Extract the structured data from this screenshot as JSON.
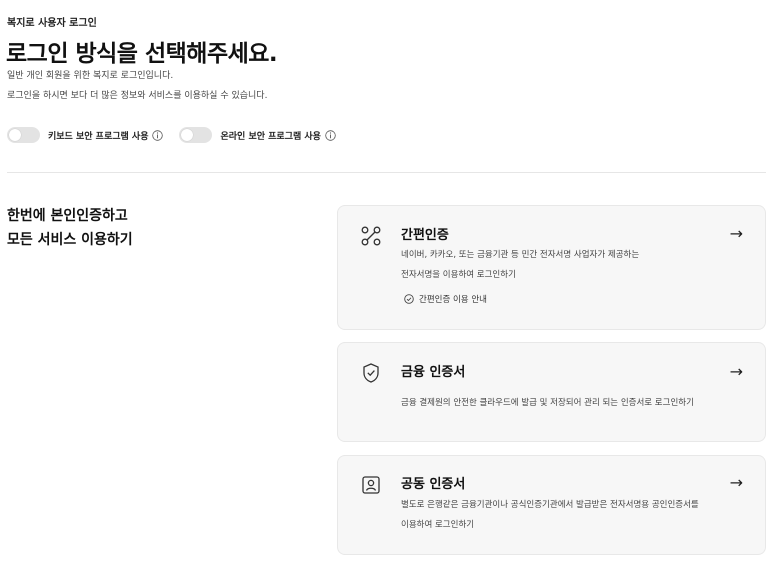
{
  "header": {
    "eyebrow": "복지로 사용자 로그인",
    "title": "로그인 방식을 선택해주세요.",
    "desc_1": "일반 개인 회원을 위한 복지로 로그인입니다.",
    "desc_2": "로그인을 하시면 보다 더 많은 정보와 서비스를 이용하실 수 있습니다."
  },
  "toggles": [
    {
      "label": "키보드 보안 프로그램 사용",
      "state": "off"
    },
    {
      "label": "온라인 보안 프로그램 사용",
      "state": "off"
    }
  ],
  "promo": {
    "line_1": "한번에 본인인증하고",
    "line_2": "모든 서비스 이용하기"
  },
  "cards": [
    {
      "icon": "route-icon",
      "title": "간편인증",
      "desc_1": "네이버, 카카오, 또는 금융기관 등 민간 전자서명 사업자가 제공하는",
      "desc_2": "전자서명을 이용하여 로그인하기",
      "guide_label": "간편인증 이용 안내",
      "arrow": "→"
    },
    {
      "icon": "shield-check-icon",
      "title": "금융 인증서",
      "desc_1": "금융 결제원의 안전한 클라우드에 발급 및 저장되어 관리 되는 인증서로 로그인하기",
      "arrow": "→"
    },
    {
      "icon": "id-card-icon",
      "title": "공동 인증서",
      "desc_1": "별도로 은행같은 금융기관이나 공식인증기관에서 발급받은 전자서명용 공인인증서를",
      "desc_2": "이용하여 로그인하기",
      "arrow": "→"
    }
  ]
}
